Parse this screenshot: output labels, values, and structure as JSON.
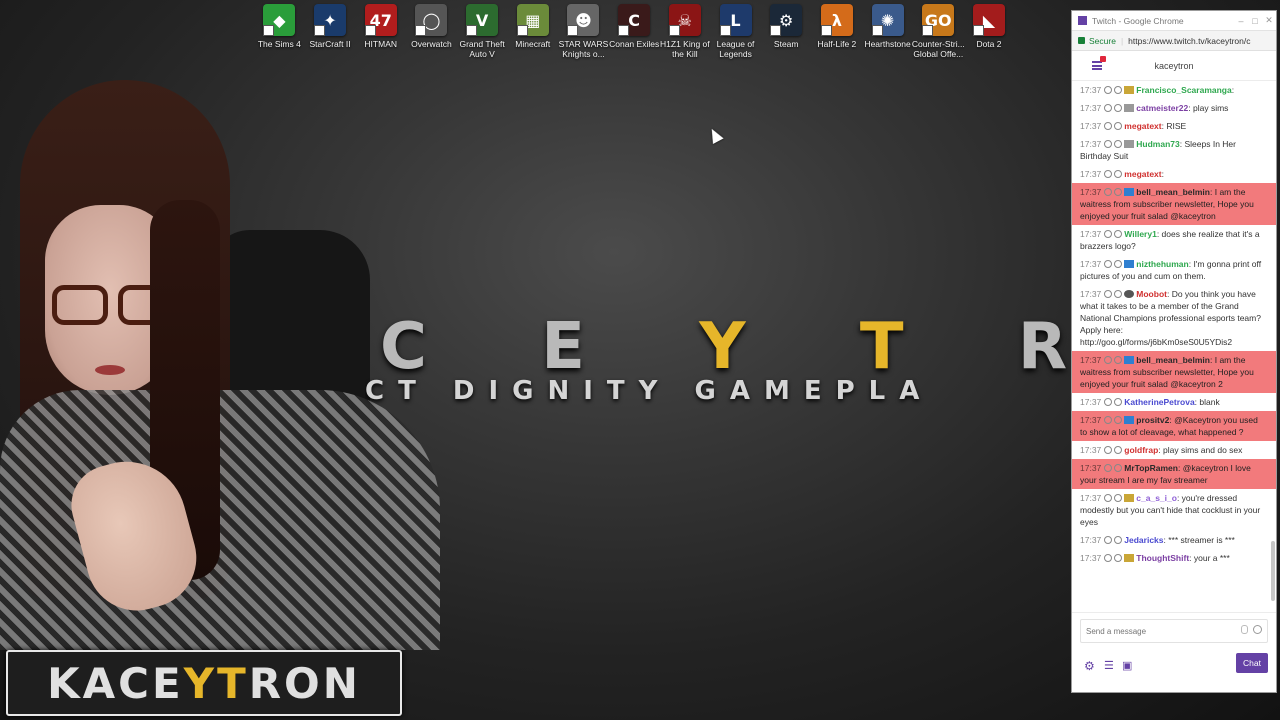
{
  "desktop_icons": [
    {
      "label": "The Sims 4",
      "color": "#2a9d3a",
      "glyph": "◆"
    },
    {
      "label": "StarCraft II",
      "color": "#1a3b6b",
      "glyph": "✦"
    },
    {
      "label": "HITMAN",
      "color": "#b11d1d",
      "glyph": "47"
    },
    {
      "label": "Overwatch",
      "color": "#555555",
      "glyph": "◯"
    },
    {
      "label": "Grand Theft Auto V",
      "color": "#2c6b2f",
      "glyph": "V"
    },
    {
      "label": "Minecraft",
      "color": "#6b8b3a",
      "glyph": "▦"
    },
    {
      "label": "STAR WARS Knights o...",
      "color": "#666666",
      "glyph": "☻"
    },
    {
      "label": "Conan Exiles",
      "color": "#3a1a1a",
      "glyph": "C"
    },
    {
      "label": "H1Z1 King of the Kill",
      "color": "#8b1515",
      "glyph": "☠"
    },
    {
      "label": "League of Legends",
      "color": "#1e3a6b",
      "glyph": "L"
    },
    {
      "label": "Steam",
      "color": "#1b2838",
      "glyph": "⚙"
    },
    {
      "label": "Half-Life 2",
      "color": "#d46b1a",
      "glyph": "λ"
    },
    {
      "label": "Hearthstone",
      "color": "#3a5a8b",
      "glyph": "✺"
    },
    {
      "label": "Counter-Stri... Global Offe...",
      "color": "#c7781a",
      "glyph": "GO"
    },
    {
      "label": "Dota 2",
      "color": "#a31c1c",
      "glyph": "◣"
    }
  ],
  "wallpaper": {
    "title_left": "C E ",
    "title_highlight": "Y T",
    "title_right": " R O",
    "tagline": "CT  DIGNITY  GAMEPLA"
  },
  "logo": {
    "left": "KACE",
    "highlight": "YT",
    "right": "RON"
  },
  "browser": {
    "window_title": "Twitch - Google Chrome",
    "secure_label": "Secure",
    "url": "https://www.twitch.tv/kaceytron/c",
    "channel": "kaceytron"
  },
  "chat": {
    "messages": [
      {
        "time": "17:37",
        "user": "Francisco_Scaramanga",
        "user_color": "#2fa84f",
        "text": "",
        "badge": "gold",
        "hi": false
      },
      {
        "time": "17:37",
        "user": "catmeister22",
        "user_color": "#7b3fa3",
        "text": "play sims",
        "badge": "grey",
        "hi": false
      },
      {
        "time": "17:37",
        "user": "megatext",
        "user_color": "#d0302f",
        "text": "RISE",
        "badge": "",
        "hi": false
      },
      {
        "time": "17:37",
        "user": "Hudman73",
        "user_color": "#2fa84f",
        "text": "Sleeps In Her Birthday Suit",
        "badge": "grey",
        "hi": false
      },
      {
        "time": "17:37",
        "user": "megatext",
        "user_color": "#d0302f",
        "text": "",
        "badge": "",
        "hi": false
      },
      {
        "time": "17:37",
        "user": "bell_mean_belmin",
        "user_color": "#2a2a2a",
        "text": "I am the waitress from subscriber newsletter, Hope you enjoyed your fruit salad @kaceytron",
        "badge": "blue",
        "hi": true
      },
      {
        "time": "17:37",
        "user": "Willery1",
        "user_color": "#2fa84f",
        "text": "does she realize that it's a brazzers logo?",
        "badge": "",
        "hi": false
      },
      {
        "time": "17:37",
        "user": "nizthehuman",
        "user_color": "#2fa84f",
        "text": "I'm gonna print off pictures of you and cum on them.",
        "badge": "blue",
        "hi": false
      },
      {
        "time": "17:37",
        "user": "Moobot",
        "user_color": "#d0302f",
        "text": "Do you think you have what it takes to be a member of the Grand National Champions professional esports team? Apply here: http://goo.gl/forms/j6bKm0seS0U5YDis2",
        "badge": "dark",
        "hi": false
      },
      {
        "time": "17:37",
        "user": "bell_mean_belmin",
        "user_color": "#2a2a2a",
        "text": "I am the waitress from subscriber newsletter, Hope you enjoyed your fruit salad @kaceytron 2",
        "badge": "blue",
        "hi": true
      },
      {
        "time": "17:37",
        "user": "KatherinePetrova",
        "user_color": "#4a4ad0",
        "text": "blank",
        "badge": "",
        "hi": false
      },
      {
        "time": "17:37",
        "user": "prositv2",
        "user_color": "#2a2a2a",
        "text": "@Kaceytron you used to show a lot of cleavage, what happened ?",
        "badge": "blue",
        "hi": true
      },
      {
        "time": "17:37",
        "user": "goldfrap",
        "user_color": "#d0302f",
        "text": "play sims and do sex",
        "badge": "",
        "hi": false
      },
      {
        "time": "17:37",
        "user": "MrTopRamen",
        "user_color": "#2a2a2a",
        "text": "@kaceytron I love your stream I are my fav streamer",
        "badge": "",
        "hi": true
      },
      {
        "time": "17:37",
        "user": "c_a_s_i_o",
        "user_color": "#8e5fd6",
        "text": "you're dressed modestly but you can't hide that cocklust in your eyes",
        "badge": "gold",
        "hi": false
      },
      {
        "time": "17:37",
        "user": "Jedaricks",
        "user_color": "#4a4ad0",
        "text": "*** streamer is ***",
        "badge": "",
        "hi": false
      },
      {
        "time": "17:37",
        "user": "ThoughtShift",
        "user_color": "#7b3fa3",
        "text": "your a ***",
        "badge": "gold",
        "hi": false
      }
    ],
    "input_placeholder": "Send a message",
    "send_label": "Chat"
  }
}
